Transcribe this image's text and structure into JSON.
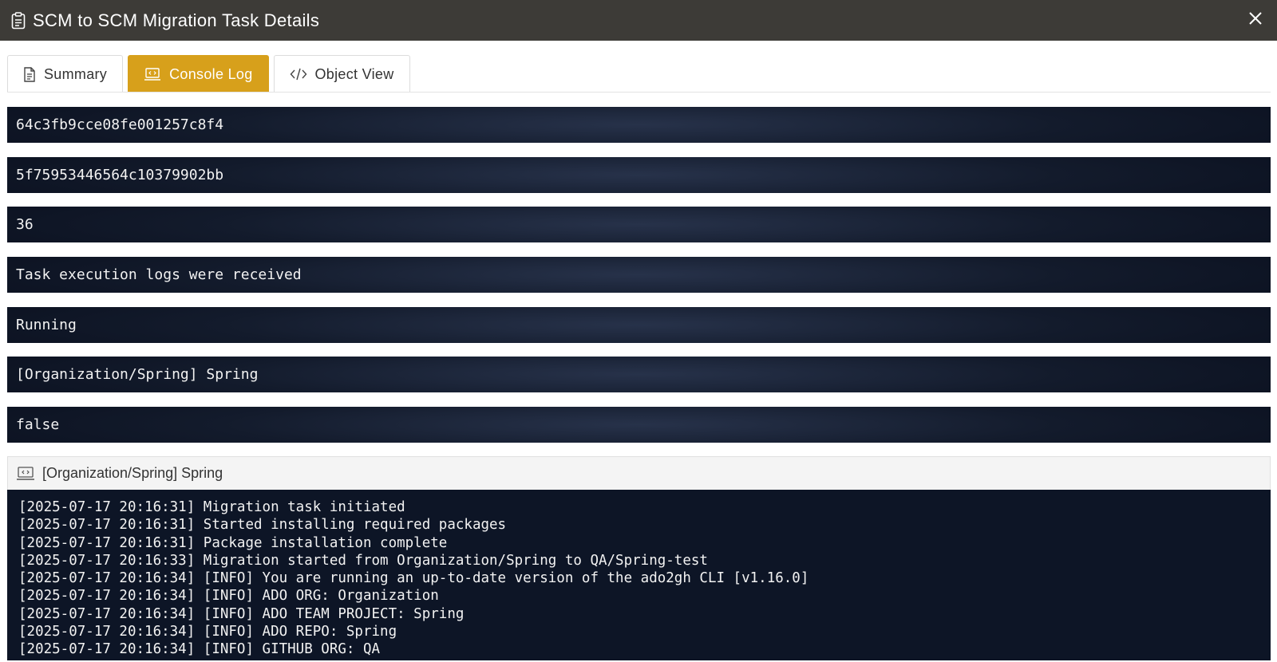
{
  "window": {
    "title": "SCM to SCM Migration Task Details",
    "title_icon": "clipboard-icon",
    "close_icon": "close-icon"
  },
  "tabs": [
    {
      "label": "Summary",
      "icon": "document-icon",
      "active": false
    },
    {
      "label": "Console Log",
      "icon": "terminal-icon",
      "active": true
    },
    {
      "label": "Object View",
      "icon": "code-icon",
      "active": false
    }
  ],
  "fields": [
    "64c3fb9cce08fe001257c8f4",
    "5f75953446564c10379902bb",
    "36",
    "Task execution logs were received",
    "Running",
    "[Organization/Spring] Spring",
    "false"
  ],
  "console": {
    "header": "[Organization/Spring] Spring",
    "header_icon": "terminal-icon",
    "lines": [
      "[2025-07-17 20:16:31] Migration task initiated",
      "[2025-07-17 20:16:31] Started installing required packages",
      "[2025-07-17 20:16:31] Package installation complete",
      "[2025-07-17 20:16:33] Migration started from Organization/Spring to QA/Spring-test",
      "[2025-07-17 20:16:34] [INFO] You are running an up-to-date version of the ado2gh CLI [v1.16.0]",
      "[2025-07-17 20:16:34] [INFO] ADO ORG: Organization",
      "[2025-07-17 20:16:34] [INFO] ADO TEAM PROJECT: Spring",
      "[2025-07-17 20:16:34] [INFO] ADO REPO: Spring",
      "[2025-07-17 20:16:34] [INFO] GITHUB ORG: QA"
    ]
  },
  "colors": {
    "titlebar": "#3d3b37",
    "accent": "#d7a01b",
    "console_bg": "#0d1526"
  }
}
